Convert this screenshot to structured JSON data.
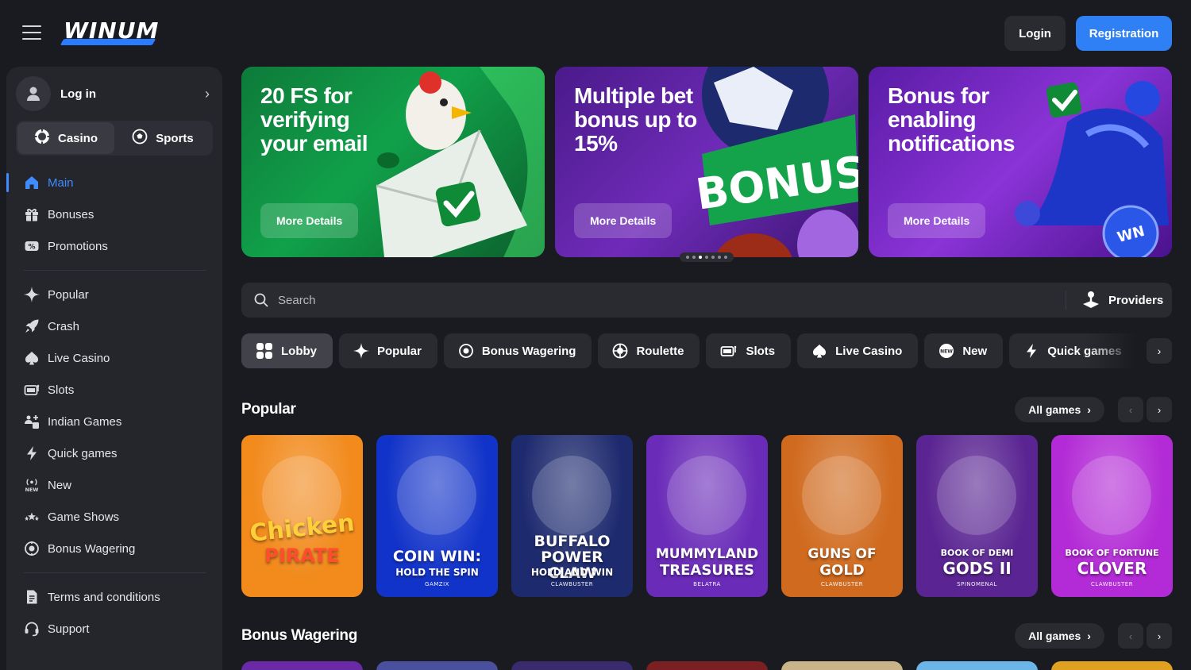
{
  "header": {
    "logo_text": "WINUM",
    "login_label": "Login",
    "register_label": "Registration"
  },
  "sidebar": {
    "login_label": "Log in",
    "tabs": [
      {
        "label": "Casino",
        "icon": "poker-chip-icon",
        "active": true
      },
      {
        "label": "Sports",
        "icon": "soccer-ball-icon",
        "active": false
      }
    ],
    "group1": [
      {
        "label": "Main",
        "icon": "home-icon",
        "active": true
      },
      {
        "label": "Bonuses",
        "icon": "gift-icon"
      },
      {
        "label": "Promotions",
        "icon": "percent-ticket-icon"
      }
    ],
    "group2": [
      {
        "label": "Popular",
        "icon": "sparkle-icon"
      },
      {
        "label": "Crash",
        "icon": "rocket-icon"
      },
      {
        "label": "Live Casino",
        "icon": "spade-icon"
      },
      {
        "label": "Slots",
        "icon": "slot-machine-icon"
      },
      {
        "label": "Indian Games",
        "icon": "indian-games-icon"
      },
      {
        "label": "Quick games",
        "icon": "lightning-icon"
      },
      {
        "label": "New",
        "icon": "new-badge-icon"
      },
      {
        "label": "Game Shows",
        "icon": "stars-icon"
      },
      {
        "label": "Bonus Wagering",
        "icon": "bonus-coin-icon"
      }
    ],
    "group3": [
      {
        "label": "Terms and conditions",
        "icon": "document-icon"
      },
      {
        "label": "Support",
        "icon": "headset-icon"
      }
    ]
  },
  "banners": [
    {
      "title": "20 FS for verifying your email",
      "button": "More Details"
    },
    {
      "title": "Multiple bet bonus up to 15%",
      "button": "More Details",
      "art_text": "BONUS"
    },
    {
      "title": "Bonus for enabling notifications",
      "button": "More Details"
    }
  ],
  "carousel": {
    "total": 7,
    "active": 2
  },
  "search": {
    "placeholder": "Search",
    "providers_label": "Providers"
  },
  "categories": [
    {
      "label": "Lobby",
      "icon": "grid-icon",
      "active": true
    },
    {
      "label": "Popular",
      "icon": "sparkle-icon"
    },
    {
      "label": "Bonus Wagering",
      "icon": "bonus-coin-icon"
    },
    {
      "label": "Roulette",
      "icon": "roulette-icon"
    },
    {
      "label": "Slots",
      "icon": "slot-machine-icon"
    },
    {
      "label": "Live Casino",
      "icon": "spade-icon"
    },
    {
      "label": "New",
      "icon": "new-badge-icon"
    },
    {
      "label": "Quick games",
      "icon": "lightning-icon"
    }
  ],
  "sections": [
    {
      "title": "Popular",
      "all_games": "All games"
    },
    {
      "title": "Bonus Wagering",
      "all_games": "All games"
    }
  ],
  "popular_games": [
    {
      "line1": "Chicken",
      "line2": "PIRATE",
      "provider": "",
      "bg": "#f28a1c"
    },
    {
      "line1": "COIN WIN:",
      "line2": "HOLD THE SPIN",
      "provider": "GAMZIX",
      "bg": "#1233c9"
    },
    {
      "line1": "BUFFALO POWER CLAW",
      "line2": "HOLD AND WIN",
      "provider": "CLAWBUSTER",
      "bg": "#1d2a6e"
    },
    {
      "line1": "MUMMYLAND",
      "line2": "TREASURES",
      "provider": "BELATRA",
      "bg": "#6a2bb8"
    },
    {
      "line1": "GUNS OF",
      "line2": "GOLD",
      "provider": "CLAWBUSTER",
      "bg": "#d06a1e"
    },
    {
      "line1": "BOOK OF DEMI",
      "line2": "GODS II",
      "provider": "SPINOMENAL",
      "bg": "#5a2592"
    },
    {
      "line1": "BOOK OF FORTUNE",
      "line2": "CLOVER",
      "provider": "CLAWBUSTER",
      "bg": "#b32bd6"
    }
  ],
  "bonus_wagering_bgs": [
    "#6a2aa8",
    "#4a4f9e",
    "#3a2b6e",
    "#7a1f22",
    "#c9b48a",
    "#6bb5e8",
    "#e0a020"
  ]
}
